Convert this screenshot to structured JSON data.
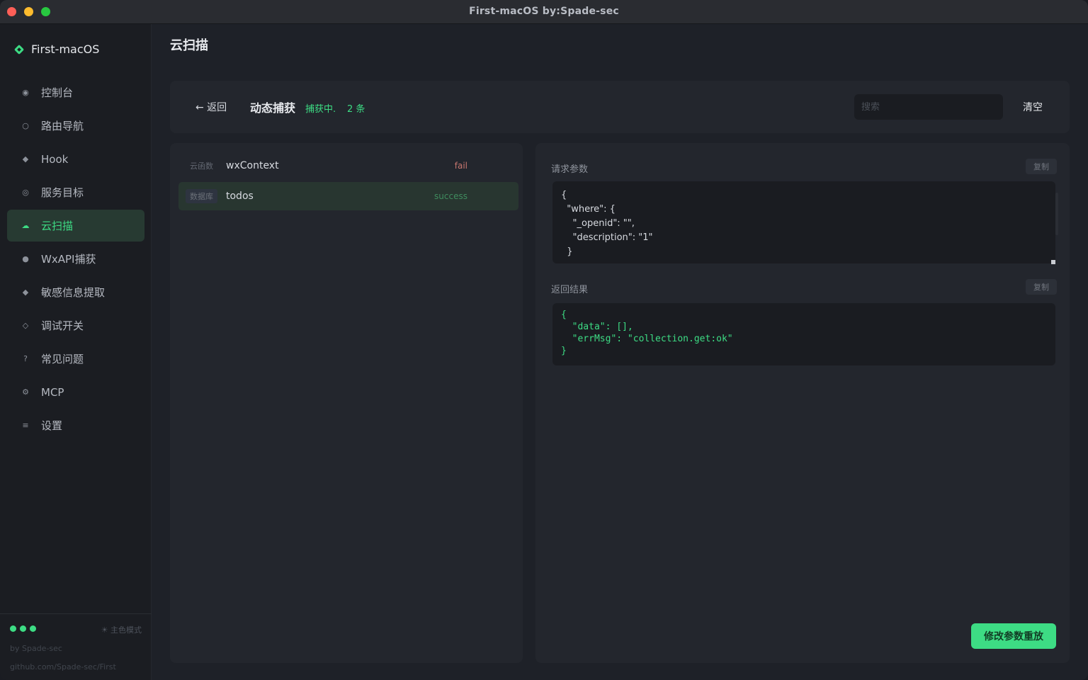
{
  "window": {
    "title": "First-macOS  by:Spade-sec"
  },
  "sidebar": {
    "brand": "First-macOS",
    "items": [
      {
        "label": "控制台",
        "icon": "dashboard-icon",
        "glyph": "◉",
        "active": false
      },
      {
        "label": "路由导航",
        "icon": "route-icon",
        "glyph": "○",
        "active": false
      },
      {
        "label": "Hook",
        "icon": "hook-icon",
        "glyph": "◆",
        "active": false
      },
      {
        "label": "服务目标",
        "icon": "target-icon",
        "glyph": "◎",
        "active": false
      },
      {
        "label": "云扫描",
        "icon": "cloud-icon",
        "glyph": "☁",
        "active": true
      },
      {
        "label": "WxAPI捕获",
        "icon": "capture-icon",
        "glyph": "●",
        "active": false
      },
      {
        "label": "敏感信息提取",
        "icon": "sensitive-icon",
        "glyph": "◆",
        "active": false
      },
      {
        "label": "调试开关",
        "icon": "debug-icon",
        "glyph": "◇",
        "active": false
      },
      {
        "label": "常见问题",
        "icon": "question-icon",
        "glyph": "?",
        "active": false
      },
      {
        "label": "MCP",
        "icon": "mcp-icon",
        "glyph": "⚙",
        "active": false
      },
      {
        "label": "设置",
        "icon": "settings-icon",
        "glyph": "≡",
        "active": false
      }
    ],
    "footer": {
      "theme": "☀ 主色模式",
      "author": "by Spade-sec",
      "link": "github.com/Spade-sec/First"
    }
  },
  "main": {
    "title": "云扫描",
    "toolbar": {
      "back": "← 返回",
      "capture_title": "动态捕获",
      "status": "捕获中.",
      "count": "2 条",
      "search_placeholder": "搜索",
      "clear": "清空"
    },
    "list": [
      {
        "tag": "云函数",
        "name": "wxContext",
        "status": "fail",
        "status_kind": "fail"
      },
      {
        "tag": "数据库",
        "name": "todos",
        "status": "success",
        "status_kind": "success"
      }
    ],
    "detail": {
      "request_label": "请求参数",
      "response_label": "返回结果",
      "copy": "复制",
      "request_body": "{\n  \"where\": {\n    \"_openid\": \"\",\n    \"description\": \"1\"\n  }",
      "response_body": "{\n  \"data\": [],\n  \"errMsg\": \"collection.get:ok\"\n}",
      "replay": "修改参数重放"
    }
  },
  "colors": {
    "accent": "#3ddc84",
    "fail": "#c7766f",
    "panel": "#23262d",
    "background": "#1e2128"
  }
}
